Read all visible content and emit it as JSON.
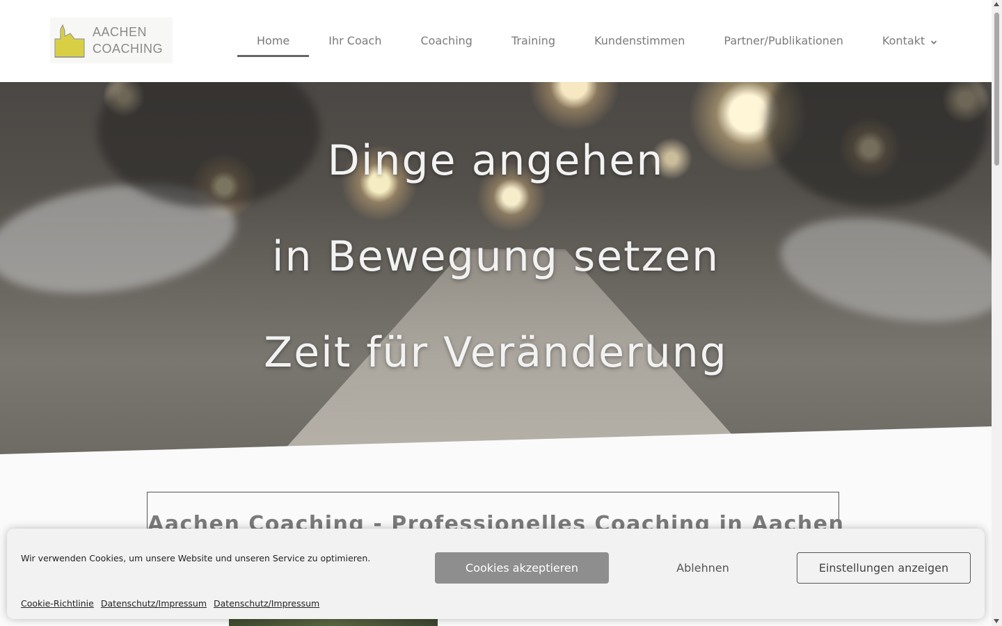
{
  "brand": {
    "logo_line1": "AACHEN",
    "logo_line2": "COACHING",
    "logo_icon": "cathedral-icon",
    "accent_color": "#d9cf45"
  },
  "nav": {
    "items": [
      {
        "label": "Home",
        "active": true
      },
      {
        "label": "Ihr Coach"
      },
      {
        "label": "Coaching"
      },
      {
        "label": "Training"
      },
      {
        "label": "Kundenstimmen"
      },
      {
        "label": "Partner/Publikationen"
      },
      {
        "label": "Kontakt",
        "icon": "chevron-down-icon"
      }
    ]
  },
  "hero": {
    "line1": "Dinge angehen",
    "line2": "in Bewegung setzen",
    "line3": "Zeit für Veränderung"
  },
  "content": {
    "title": "Aachen Coaching - Professionelles Coaching in Aachen"
  },
  "cookie_banner": {
    "message": "Wir verwenden Cookies, um unsere Website und unseren Service zu optimieren.",
    "accept_label": "Cookies akzeptieren",
    "deny_label": "Ablehnen",
    "settings_label": "Einstellungen anzeigen",
    "links": [
      "Cookie-Richtlinie",
      "Datenschutz/Impressum",
      "Datenschutz/Impressum"
    ]
  }
}
